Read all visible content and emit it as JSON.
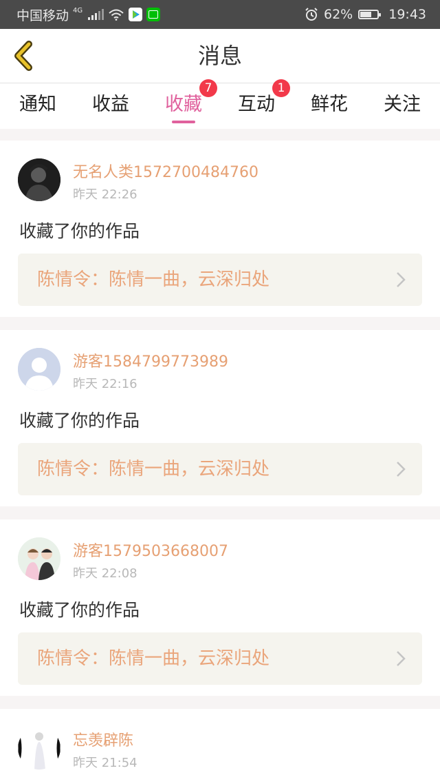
{
  "status_bar": {
    "carrier": "中国移动",
    "network": "4G",
    "battery": "62%",
    "time": "19:43",
    "icons": [
      "signal-icon",
      "wifi-icon",
      "video-app-icon",
      "iqiyi-app-icon",
      "alarm-icon",
      "battery-icon"
    ]
  },
  "header": {
    "title": "消息",
    "back_icon": "chevron-left-icon"
  },
  "tabs": [
    {
      "label": "通知",
      "badge": null,
      "active": false
    },
    {
      "label": "收益",
      "badge": null,
      "active": false
    },
    {
      "label": "收藏",
      "badge": "7",
      "active": true
    },
    {
      "label": "互动",
      "badge": "1",
      "active": false
    },
    {
      "label": "鲜花",
      "badge": null,
      "active": false
    },
    {
      "label": "关注",
      "badge": null,
      "active": false
    }
  ],
  "messages": [
    {
      "user": "无名人类1572700484760",
      "time": "昨天 22:26",
      "action": "收藏了你的作品",
      "work": "陈情令：陈情一曲，云深归处"
    },
    {
      "user": "游客1584799773989",
      "time": "昨天 22:16",
      "action": "收藏了你的作品",
      "work": "陈情令：陈情一曲，云深归处"
    },
    {
      "user": "游客1579503668007",
      "time": "昨天 22:08",
      "action": "收藏了你的作品",
      "work": "陈情令：陈情一曲，云深归处"
    },
    {
      "user": "忘羡辟陈",
      "time": "昨天 21:54"
    }
  ],
  "colors": {
    "accent": "#e0619d",
    "badge": "#f2394a",
    "username": "#e6a073",
    "work_text": "#eaa57b",
    "back_icon": "#c9a012"
  }
}
